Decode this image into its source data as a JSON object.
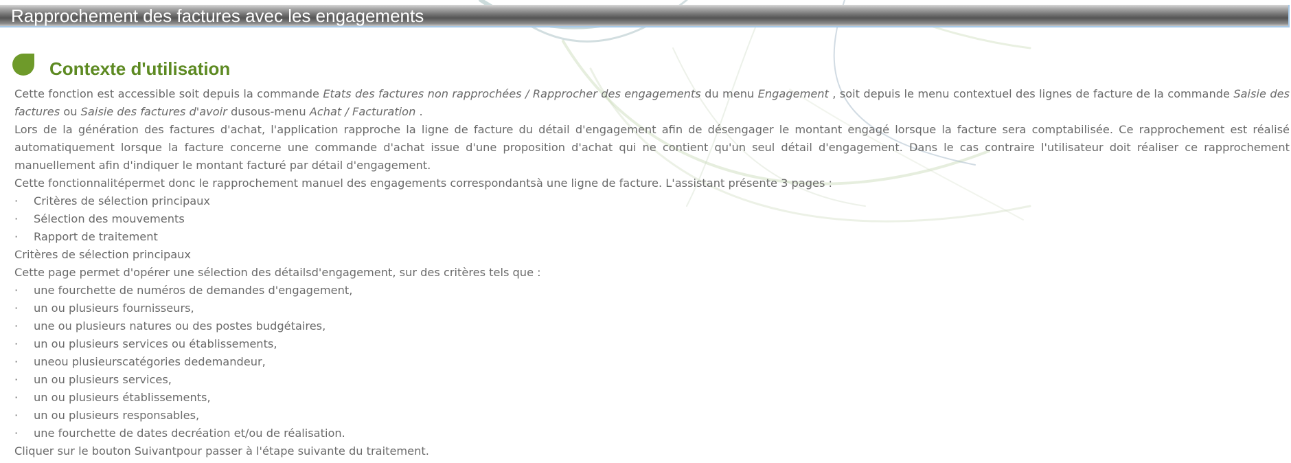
{
  "header": {
    "title": "Rapprochement des factures avec les engagements"
  },
  "section": {
    "icon": "leaf-icon",
    "title": "Contexte d'utilisation"
  },
  "paragraph1": {
    "t1": "Cette fonction est accessible soit depuis la commande ",
    "e1": "Etats des factures non rapprochées / Rapprocher des engagements",
    "t2": " du menu ",
    "e2": "Engagement",
    "t3": " , soit depuis le menu contextuel des lignes de facture de la commande ",
    "e3": "Saisie des factures",
    "t4": " ou ",
    "e4": "Saisie des factures d'avoir",
    "t5": " dusous-menu ",
    "e5": "Achat / Facturation",
    "t6": " ."
  },
  "paragraph2": "Lors de la génération des factures d'achat, l'application rapproche la ligne de facture du détail d'engagement afin de désengager le montant engagé lorsque la facture sera comptabilisée. Ce rapprochement est réalisé automatiquement lorsque la facture concerne une commande d'achat issue d'une proposition d'achat qui ne contient qu'un seul détail d'engagement. Dans le cas contraire l'utilisateur doit réaliser ce rapprochement manuellement afin d'indiquer le montant facturé par détail d'engagement.",
  "paragraph3": "Cette fonctionnalitépermet donc le rapprochement manuel des engagements correspondantsà une ligne de facture. L'assistant présente 3 pages :",
  "bullet_char": "·",
  "pages": [
    "Critères de sélection principaux",
    "Sélection des mouvements",
    "Rapport de traitement"
  ],
  "subheading": "Critères de sélection principaux",
  "paragraph4": "Cette page permet d'opérer une sélection des détailsd'engagement, sur des critères tels que :",
  "criteria": [
    "une fourchette de numéros de demandes d'engagement,",
    "un ou plusieurs fournisseurs,",
    "une ou plusieurs natures ou des postes budgétaires,",
    "un ou plusieurs services ou établissements,",
    "uneou plusieurscatégories dedemandeur,",
    "un ou plusieurs services,",
    "un ou plusieurs établissements,",
    "un ou plusieurs responsables,",
    "une fourchette de dates decréation et/ou de réalisation."
  ],
  "paragraph5": "Cliquer sur le bouton Suivantpour passer à l'étape suivante du traitement.",
  "colors": {
    "title_text": "#ffffff",
    "section_green": "#5d8a22",
    "body_text": "#6a6a6a",
    "titlebar_border": "#a6c8e6"
  }
}
